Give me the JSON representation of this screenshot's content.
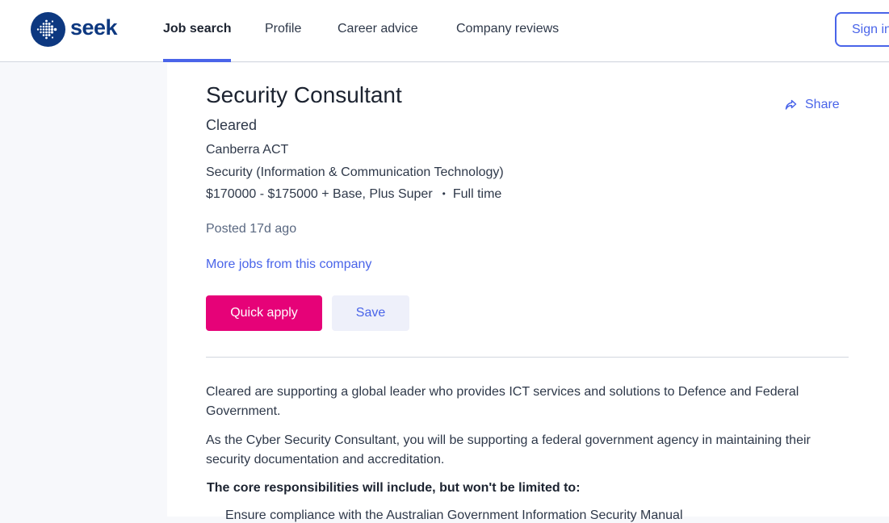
{
  "header": {
    "logo_text": "seek",
    "nav": [
      {
        "label": "Job search",
        "active": true
      },
      {
        "label": "Profile",
        "active": false
      },
      {
        "label": "Career advice",
        "active": false
      },
      {
        "label": "Company reviews",
        "active": false
      }
    ],
    "sign_in_label": "Sign in"
  },
  "job": {
    "title": "Security Consultant",
    "company": "Cleared",
    "location": "Canberra ACT",
    "classification": "Security (Information & Communication Technology)",
    "salary": "$170000 - $175000 + Base, Plus Super",
    "separator": "•",
    "work_type": "Full time",
    "posted": "Posted 17d ago",
    "more_jobs_link": "More jobs from this company",
    "share_label": "Share",
    "quick_apply_label": "Quick apply",
    "save_label": "Save"
  },
  "description": {
    "para1": "Cleared are supporting a global leader who provides ICT services and solutions to Defence and Federal Government.",
    "para2": "As the Cyber Security Consultant, you will be supporting a federal government agency in maintaining their security documentation and accreditation.",
    "heading": "The core responsibilities will include, but won't be limited to:",
    "bullet1": "Ensure compliance with the Australian Government Information Security Manual"
  },
  "colors": {
    "brand": "#0d3880",
    "accent": "#4964e9",
    "apply": "#e60278"
  },
  "icons": [
    "seek-logo-icon",
    "share-icon"
  ]
}
